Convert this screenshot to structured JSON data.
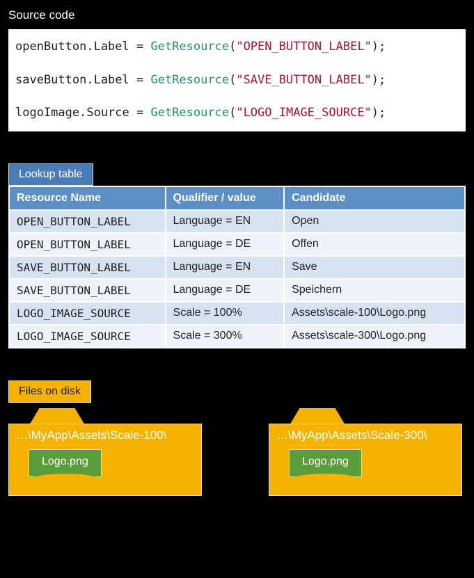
{
  "sourceCode": {
    "label": "Source code",
    "lines": [
      {
        "obj": "openButton.Label",
        "op": " = ",
        "func": "GetResource",
        "lp": "(",
        "str": "\"OPEN_BUTTON_LABEL\"",
        "rp": ");"
      },
      {
        "obj": "saveButton.Label",
        "op": " = ",
        "func": "GetResource",
        "lp": "(",
        "str": "\"SAVE_BUTTON_LABEL\"",
        "rp": ");"
      },
      {
        "obj": "logoImage.Source",
        "op": " = ",
        "func": "GetResource",
        "lp": "(",
        "str": "\"LOGO_IMAGE_SOURCE\"",
        "rp": ");"
      }
    ]
  },
  "lookup": {
    "label": "Lookup table",
    "headers": {
      "c0": "Resource Name",
      "c1": "Qualifier / value",
      "c2": "Candidate"
    },
    "rows": [
      {
        "name": "OPEN_BUTTON_LABEL",
        "qual": "Language = EN",
        "cand": "Open"
      },
      {
        "name": "OPEN_BUTTON_LABEL",
        "qual": "Language = DE",
        "cand": "Offen"
      },
      {
        "name": "SAVE_BUTTON_LABEL",
        "qual": "Language = EN",
        "cand": "Save"
      },
      {
        "name": "SAVE_BUTTON_LABEL",
        "qual": "Language = DE",
        "cand": "Speichern"
      },
      {
        "name": "LOGO_IMAGE_SOURCE",
        "qual": "Scale = 100%",
        "cand": "Assets\\scale-100\\Logo.png"
      },
      {
        "name": "LOGO_IMAGE_SOURCE",
        "qual": "Scale = 300%",
        "cand": "Assets\\scale-300\\Logo.png"
      }
    ]
  },
  "files": {
    "label": "Files on disk",
    "folders": [
      {
        "path": "…\\MyApp\\Assets\\Scale-100\\",
        "file": "Logo.png"
      },
      {
        "path": "…\\MyApp\\Assets\\Scale-300\\",
        "file": "Logo.png"
      }
    ]
  }
}
